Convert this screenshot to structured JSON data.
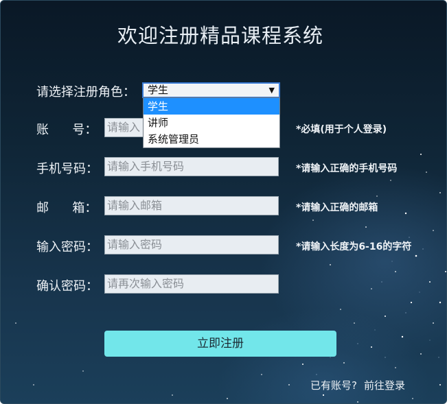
{
  "page": {
    "title": "欢迎注册精品课程系统"
  },
  "role": {
    "label": "请选择注册角色：",
    "selected": "学生",
    "options": [
      "学生",
      "讲师",
      "系统管理员"
    ]
  },
  "fields": [
    {
      "label": "账      号：",
      "placeholder": "请输入账号",
      "shown": "请输入",
      "hint": "*必填(用于个人登录)"
    },
    {
      "label": "手机号码：",
      "placeholder": "请输入手机号码",
      "shown": "请输入手机号码",
      "hint": "*请输入正确的手机号码"
    },
    {
      "label": "邮      箱：",
      "placeholder": "请输入邮箱",
      "shown": "请输入邮箱",
      "hint": "*请输入正确的邮箱"
    },
    {
      "label": "输入密码：",
      "placeholder": "请输入密码",
      "shown": "请输入密码",
      "hint": "*请输入长度为6-16的字符"
    },
    {
      "label": "确认密码：",
      "placeholder": "请再次输入密码",
      "shown": "请再次输入密码",
      "hint": ""
    }
  ],
  "actions": {
    "register": "立即注册",
    "have_account": "已有账号?",
    "goto_login": "前往登录"
  },
  "colors": {
    "accent_button": "#72e6ea",
    "dropdown_highlight": "#1e90ff"
  }
}
